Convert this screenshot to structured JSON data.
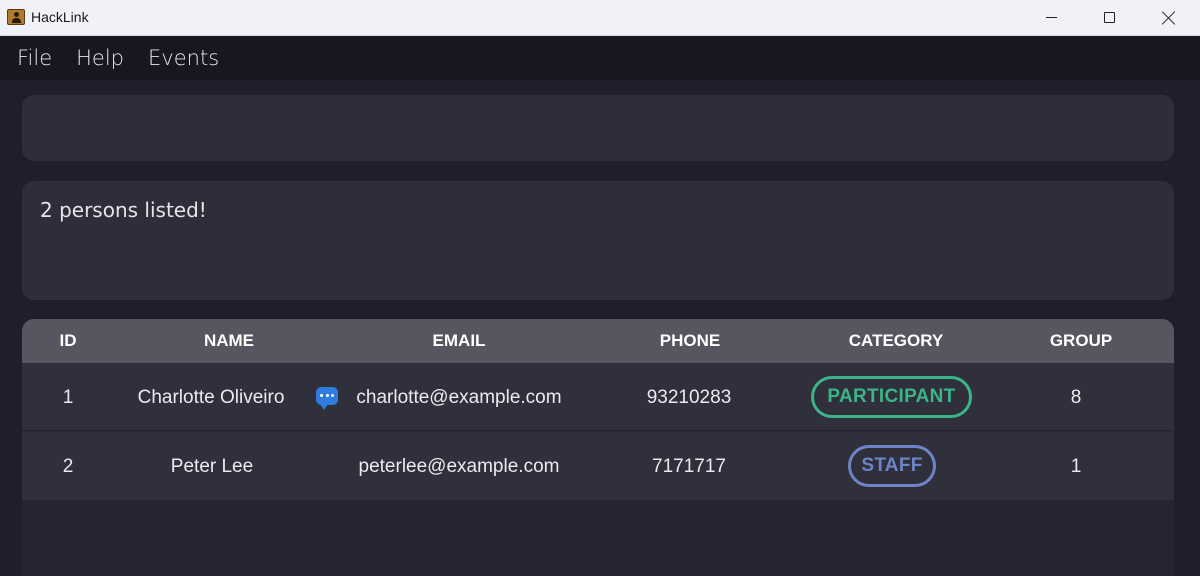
{
  "window": {
    "title": "HackLink",
    "controls": [
      "minimize-icon",
      "maximize-icon",
      "close-icon"
    ]
  },
  "menu": {
    "items": [
      "File",
      "Help",
      "Events"
    ]
  },
  "command_box": {
    "value": ""
  },
  "result": {
    "text": "2 persons listed!"
  },
  "table": {
    "headers": [
      "ID",
      "NAME",
      "EMAIL",
      "PHONE",
      "CATEGORY",
      "GROUP"
    ],
    "rows": [
      {
        "id": "1",
        "name": "Charlotte Oliveiro",
        "email": "charlotte@example.com",
        "email_icon": "chat-bubble-icon",
        "phone": "93210283",
        "category": "PARTICIPANT",
        "group": "8"
      },
      {
        "id": "2",
        "name": "Peter Lee",
        "email": "peterlee@example.com",
        "phone": "7171717",
        "category": "STAFF",
        "group": "1"
      }
    ]
  },
  "colors": {
    "participant": "#3bb489",
    "staff": "#6e84c8",
    "background": "#1f1f2b"
  }
}
